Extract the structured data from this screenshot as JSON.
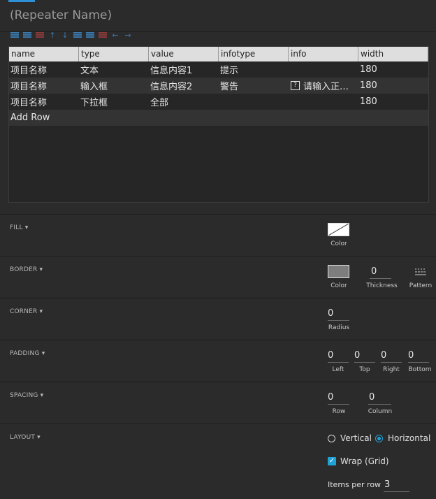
{
  "repeater_name_placeholder": "(Repeater Name)",
  "toolbar": {
    "icons": [
      "add-row-above-icon",
      "add-row-below-icon",
      "delete-row-icon",
      "move-up-icon",
      "move-down-icon",
      "add-column-left-icon",
      "add-column-right-icon",
      "delete-column-icon",
      "move-left-icon",
      "move-right-icon"
    ]
  },
  "grid": {
    "columns": [
      "name",
      "type",
      "value",
      "infotype",
      "info",
      "width"
    ],
    "rows": [
      {
        "name": "项目名称",
        "type": "文本",
        "value": "信息内容1",
        "infotype": "提示",
        "info": "",
        "width": "180"
      },
      {
        "name": "项目名称",
        "type": "输入框",
        "value": "信息内容2",
        "infotype": "警告",
        "info": "请输入正…",
        "width": "180"
      },
      {
        "name": "项目名称",
        "type": "下拉框",
        "value": "全部",
        "infotype": "",
        "info": "",
        "width": "180"
      }
    ],
    "add_row_label": "Add Row"
  },
  "sections": {
    "fill": {
      "label": "FILL ▾",
      "color_label": "Color"
    },
    "border": {
      "label": "BORDER ▾",
      "color_label": "Color",
      "thickness_value": "0",
      "thickness_label": "Thickness",
      "pattern_label": "Pattern"
    },
    "corner": {
      "label": "CORNER ▾",
      "radius_value": "0",
      "radius_label": "Radius"
    },
    "padding": {
      "label": "PADDING ▾",
      "left_value": "0",
      "left_label": "Left",
      "top_value": "0",
      "top_label": "Top",
      "right_value": "0",
      "right_label": "Right",
      "bottom_value": "0",
      "bottom_label": "Bottom"
    },
    "spacing": {
      "label": "SPACING ▾",
      "row_value": "0",
      "row_label": "Row",
      "column_value": "0",
      "column_label": "Column"
    },
    "layout": {
      "label": "LAYOUT ▾",
      "vertical_label": "Vertical",
      "horizontal_label": "Horizontal",
      "selected": "Horizontal",
      "wrap_label": "Wrap (Grid)",
      "wrap_checked": true,
      "items_per_row_label": "Items per row",
      "items_per_row_value": "3"
    }
  },
  "colors": {
    "accent": "#1fa3d6",
    "background": "#2b2b2b"
  }
}
